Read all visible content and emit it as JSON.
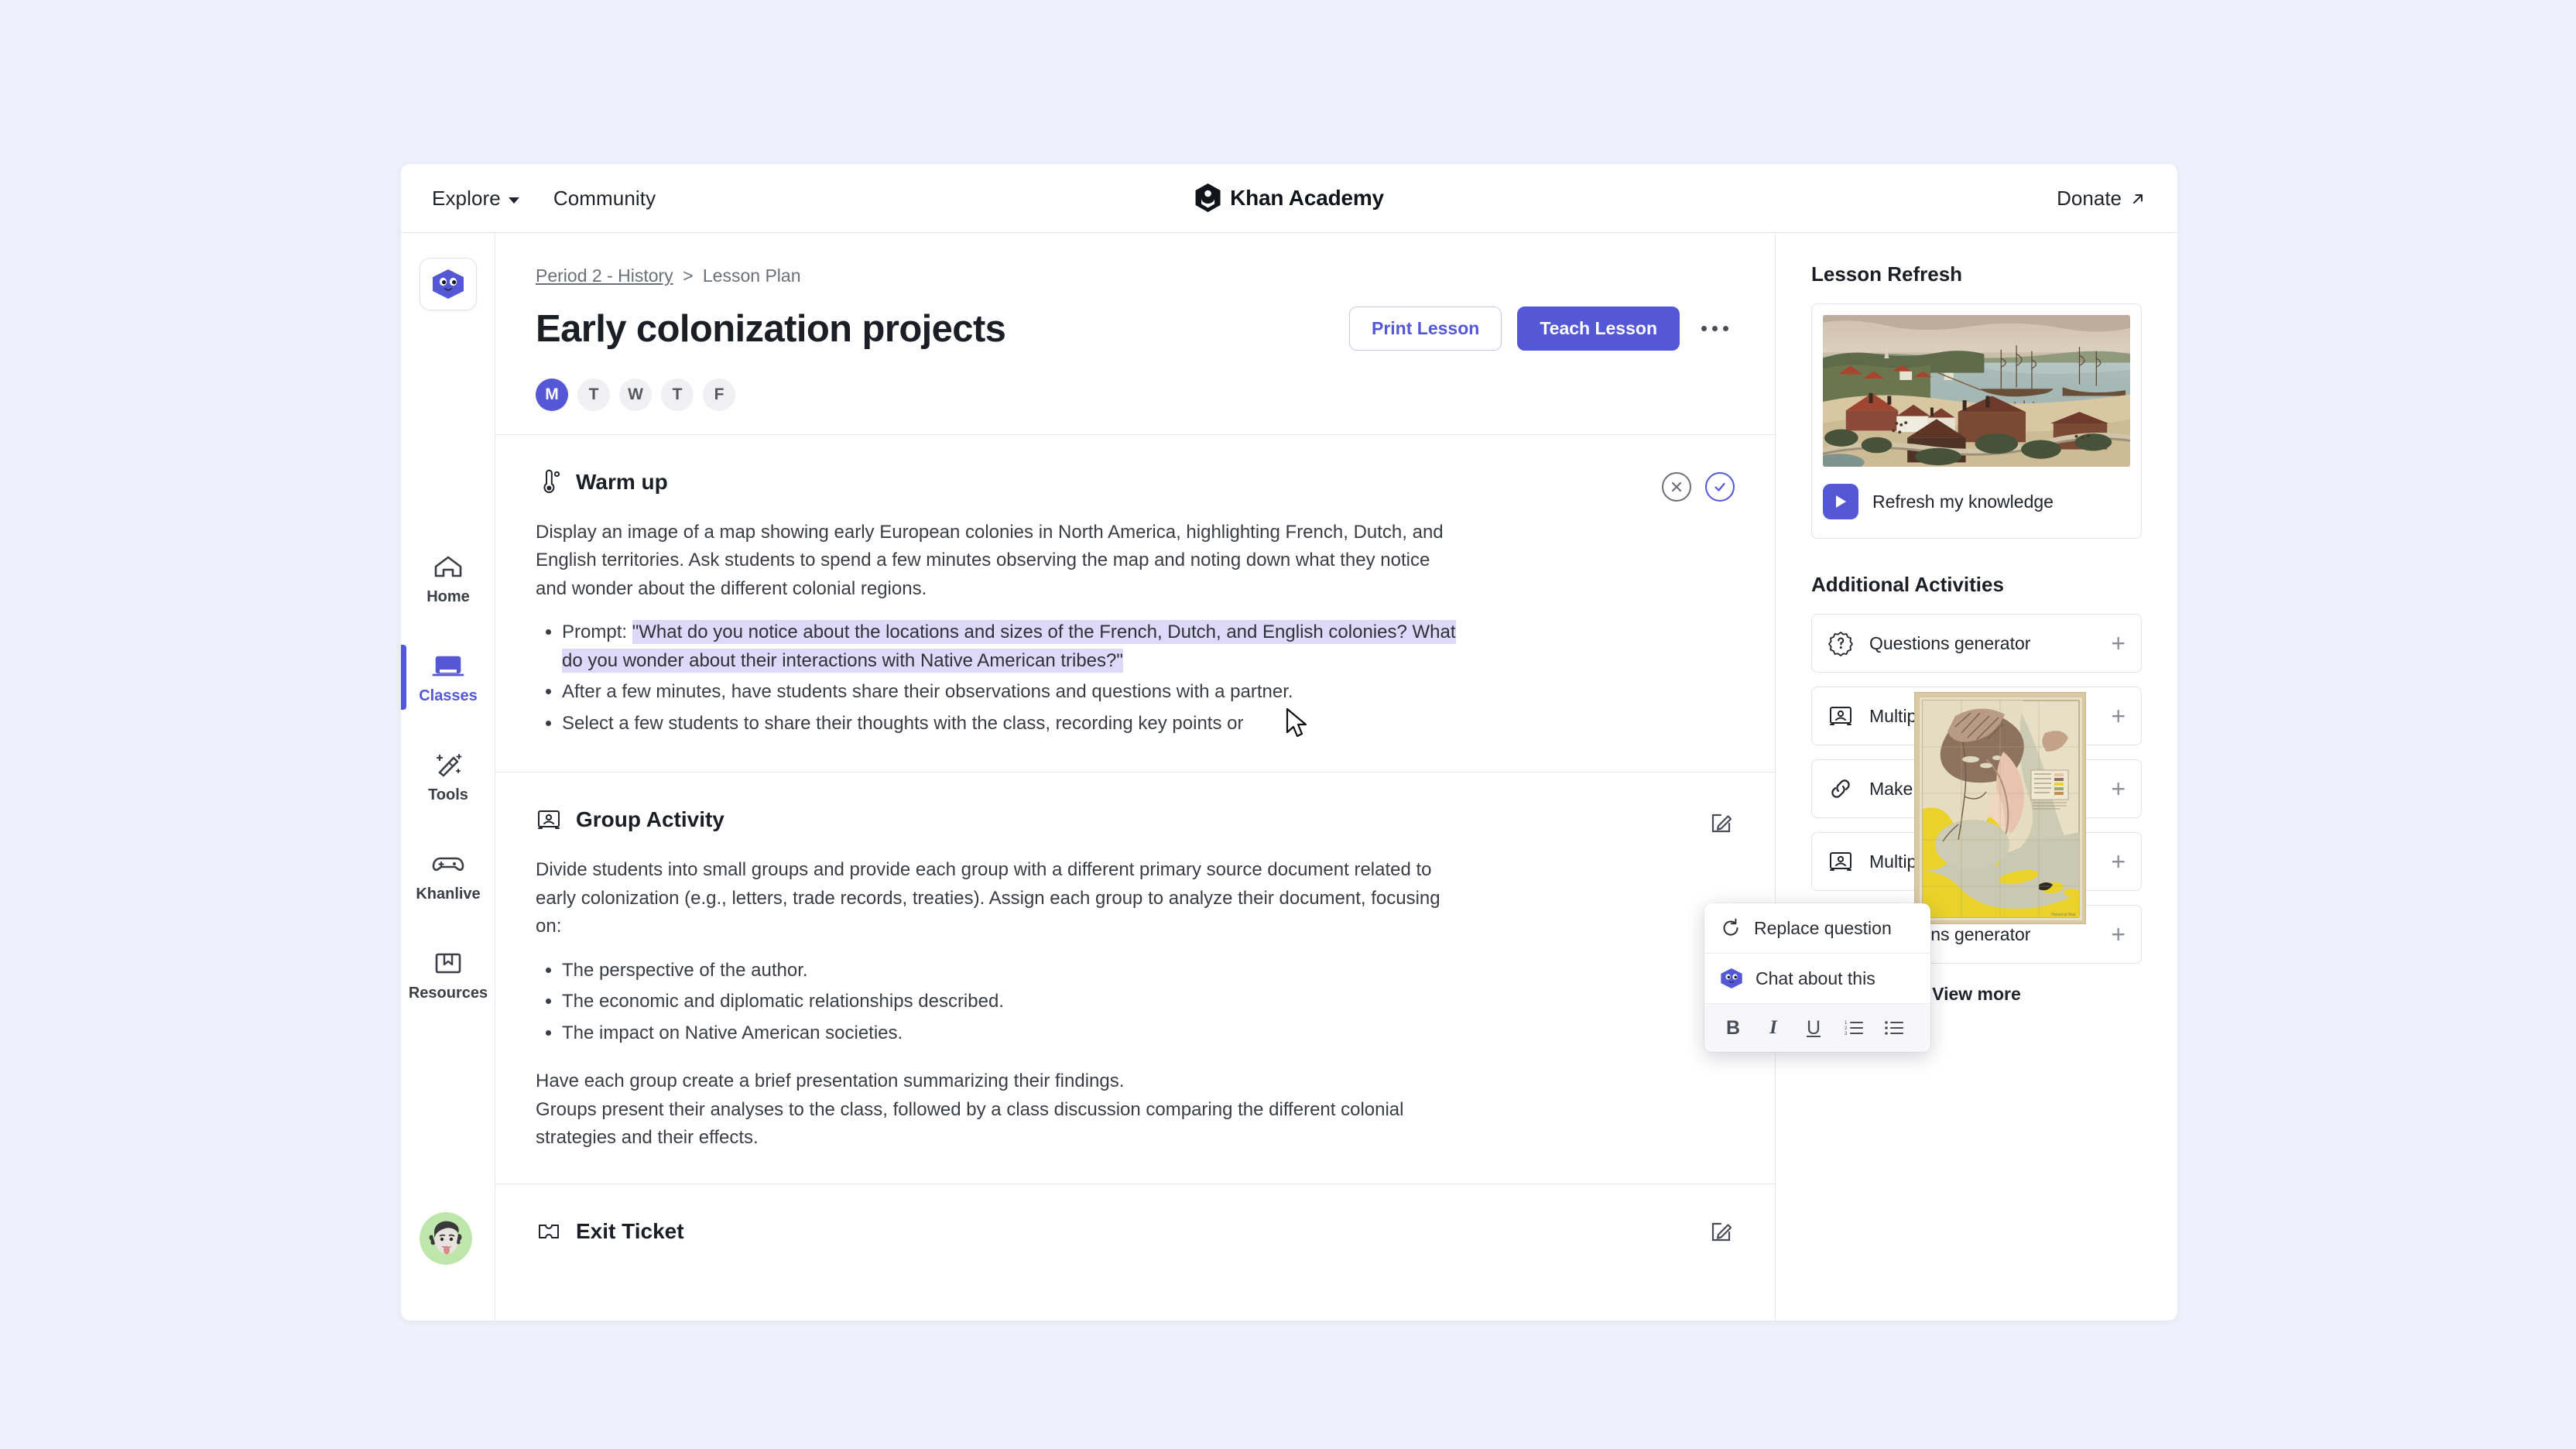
{
  "topnav": {
    "explore": "Explore",
    "community": "Community",
    "brand": "Khan Academy",
    "donate": "Donate"
  },
  "rail": {
    "khanmigo_icon": "khanmigo-icon",
    "items": [
      {
        "label": "Home",
        "icon": "home-icon",
        "active": false
      },
      {
        "label": "Classes",
        "icon": "classes-icon",
        "active": true
      },
      {
        "label": "Tools",
        "icon": "tools-icon",
        "active": false
      },
      {
        "label": "Khanlive",
        "icon": "gamepad-icon",
        "active": false
      },
      {
        "label": "Resources",
        "icon": "book-icon",
        "active": false
      }
    ]
  },
  "header": {
    "breadcrumb_parent": "Period 2 - History",
    "breadcrumb_sep": ">",
    "breadcrumb_current": "Lesson Plan",
    "title": "Early colonization projects",
    "print_label": "Print Lesson",
    "teach_label": "Teach Lesson",
    "days": [
      {
        "letter": "M",
        "selected": true
      },
      {
        "letter": "T",
        "selected": false
      },
      {
        "letter": "W",
        "selected": false
      },
      {
        "letter": "T",
        "selected": false
      },
      {
        "letter": "F",
        "selected": false
      }
    ]
  },
  "sections": {
    "warmup": {
      "title": "Warm up",
      "icon": "thermometer-icon",
      "paragraph": "Display an image of a map showing early European colonies in North America, highlighting French, Dutch, and English territories. Ask students to spend a few minutes observing the map and noting down what they notice and wonder about the different colonial regions.",
      "bullet1_prefix": "Prompt: ",
      "bullet1_highlight": "\"What do you notice about the locations and sizes of the French, Dutch, and English colonies? What do you wonder about their interactions with Native American tribes?\"",
      "bullet2": "After a few minutes, have students share their observations and questions with a partner.",
      "bullet3": "Select a few students to share their thoughts with the class, recording key points or",
      "reject_icon": "close-circle-icon",
      "accept_icon": "check-circle-icon",
      "thumb_alt": "colonial-map-thumbnail"
    },
    "group": {
      "title": "Group Activity",
      "icon": "presentation-icon",
      "edit_icon": "edit-icon",
      "paragraph": "Divide students into small groups and provide each group with a different primary source document related to early colonization (e.g., letters, trade records, treaties). Assign each group to analyze their document, focusing on:",
      "bullets": [
        "The perspective of the author.",
        "The economic and diplomatic relationships described.",
        "The impact on Native American societies."
      ],
      "closing1": "Have each group create a brief presentation summarizing their findings.",
      "closing2": "Groups present their analyses to the class, followed by a class discussion comparing the different colonial strategies and their effects."
    },
    "exit": {
      "title": "Exit Ticket",
      "icon": "ticket-icon",
      "edit_icon": "edit-icon"
    }
  },
  "float_menu": {
    "replace": "Replace question",
    "replace_icon": "refresh-icon",
    "chat": "Chat about this",
    "chat_icon": "khanmigo-icon",
    "tools": [
      {
        "label": "B",
        "name": "bold-button"
      },
      {
        "label": "I",
        "name": "italic-button"
      },
      {
        "label": "U",
        "name": "underline-button"
      },
      {
        "label": "",
        "name": "ordered-list-button"
      },
      {
        "label": "",
        "name": "bullet-list-button"
      }
    ]
  },
  "right_panel": {
    "lesson_refresh_title": "Lesson Refresh",
    "refresh_label": "Refresh my knowledge",
    "refresh_image_alt": "colonial-harbor-illustration",
    "additional_title": "Additional Activities",
    "activities": [
      {
        "label": "Questions generator",
        "icon": "question-badge-icon"
      },
      {
        "label": "Multiple Choice Quiz",
        "icon": "presentation-icon"
      },
      {
        "label": "Make it relevant",
        "icon": "link-icon"
      },
      {
        "label": "Multiple Choice Quiz",
        "icon": "presentation-icon"
      },
      {
        "label": "Questions generator",
        "icon": "question-badge-icon"
      }
    ],
    "view_more": "View more"
  },
  "colors": {
    "accent": "#5457d6",
    "page_bg": "#eef1fb",
    "highlight": "#ded9f8",
    "text": "#21242c"
  }
}
